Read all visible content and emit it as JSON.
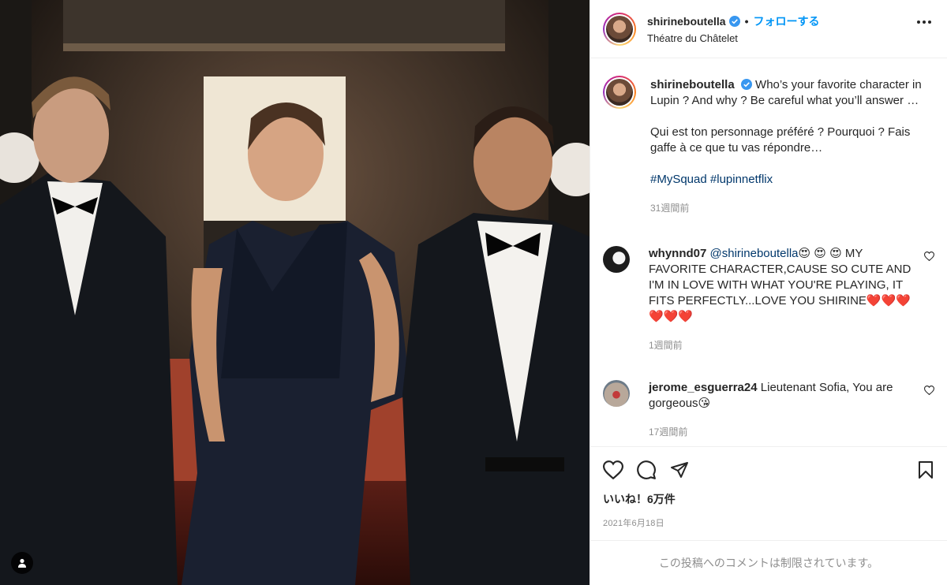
{
  "post": {
    "username": "shirineboutella",
    "follow_label": "フォローする",
    "dot": "•",
    "location": "Théatre du Châtelet",
    "caption": {
      "line1": "Who’s your favorite character in Lupin ? And why ? Be careful what you’ll answer …",
      "line2": "Qui est ton personnage préféré ? Pourquoi ? Fais gaffe à ce que tu vas répondre…",
      "hashtags": [
        "#MySquad",
        "#lupinnetflix"
      ],
      "time": "31週間前"
    },
    "comments": [
      {
        "username": "whynnd07",
        "mention": "@shirineboutella",
        "text": "😍 😍 😍 MY FAVORITE CHARACTER,CAUSE SO CUTE AND I'M IN LOVE WITH WHAT YOU'RE PLAYING, IT FITS PERFECTLY...LOVE YOU SHIRINE❤️❤️❤️❤️❤️❤️",
        "time": "1週間前",
        "avatar_color": "#1c1c1c"
      },
      {
        "username": "jerome_esguerra24",
        "mention": "",
        "text": "Lieutenant Sofia, You are gorgeous😘",
        "time": "17週間前",
        "avatar_color": "#b8a89a"
      }
    ],
    "likes": "いいね！6万件",
    "date": "2021年6月18日",
    "restricted_text": "この投稿へのコメントは制限されています。"
  },
  "colors": {
    "link_blue": "#0095f6",
    "hashtag_blue": "#00376b",
    "muted": "#8e8e8e",
    "verified_blue": "#3897f0"
  },
  "icons": [
    "heart-icon",
    "comment-icon",
    "share-icon",
    "bookmark-icon",
    "more-icon",
    "verified-badge-icon",
    "user-tag-icon"
  ]
}
